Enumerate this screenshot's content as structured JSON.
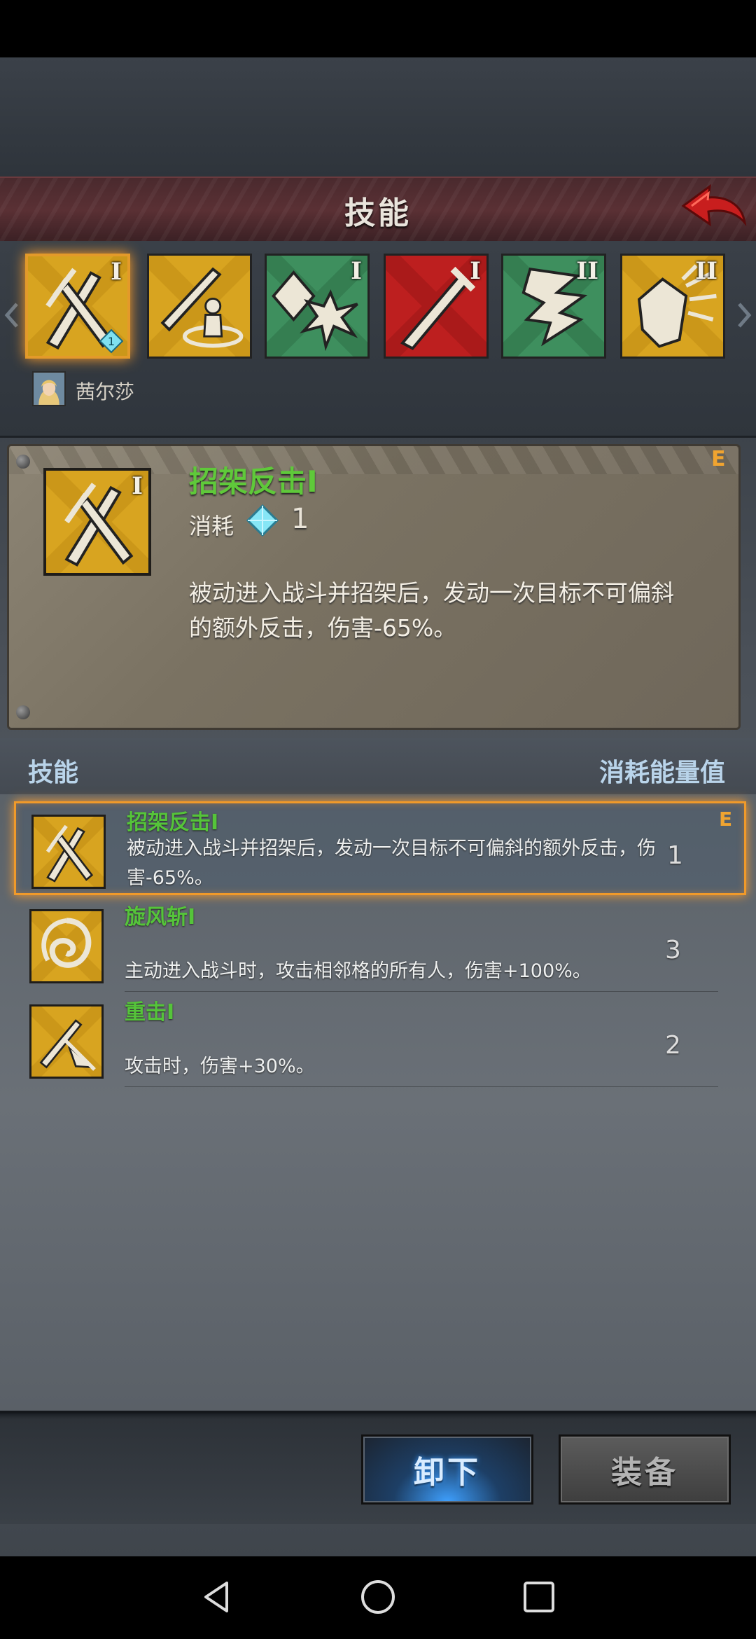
{
  "header": {
    "title": "技能"
  },
  "skill_tabs": [
    {
      "name": "parry-counter",
      "roman": "I",
      "bg": "#d6a520",
      "selected": true,
      "gem_count": "1"
    },
    {
      "name": "whirl",
      "roman": "",
      "bg": "#d6a520",
      "selected": false
    },
    {
      "name": "shatter",
      "roman": "I",
      "bg": "#3e8f5e",
      "selected": false
    },
    {
      "name": "sword-strike",
      "roman": "I",
      "bg": "#b81f1f",
      "selected": false
    },
    {
      "name": "claw",
      "roman": "II",
      "bg": "#3e8f5e",
      "selected": false
    },
    {
      "name": "shield-burst",
      "roman": "II",
      "bg": "#d6a520",
      "selected": false
    }
  ],
  "character": {
    "name": "茜尔莎"
  },
  "detail": {
    "name": "招架反击I",
    "grade": "E",
    "cost_label": "消耗",
    "cost_value": "1",
    "icon_roman": "I",
    "description": "被动进入战斗并招架后，发动一次目标不可偏斜的额外反击，伤害-65%。"
  },
  "list_header": {
    "left": "技能",
    "right": "消耗能量值"
  },
  "skills": [
    {
      "name": "招架反击I",
      "desc": "被动进入战斗并招架后，发动一次目标不可偏斜的额外反击，伤害-65%。",
      "cost": "1",
      "grade": "E",
      "selected": true
    },
    {
      "name": "旋风斩I",
      "desc": "主动进入战斗时，攻击相邻格的所有人，伤害+100%。",
      "cost": "3",
      "grade": "",
      "selected": false
    },
    {
      "name": "重击I",
      "desc": "攻击时，伤害+30%。",
      "cost": "2",
      "grade": "",
      "selected": false
    }
  ],
  "buttons": {
    "unequip": "卸下",
    "equip": "装备"
  },
  "colors": {
    "accent_orange": "#f09a2a",
    "skill_green": "#55c43a",
    "header_blue": "#b9d4ea"
  },
  "icons": {
    "back": "back-arrow-icon",
    "nav_back": "nav-back-icon",
    "nav_home": "nav-home-icon",
    "nav_recent": "nav-recent-icon"
  }
}
